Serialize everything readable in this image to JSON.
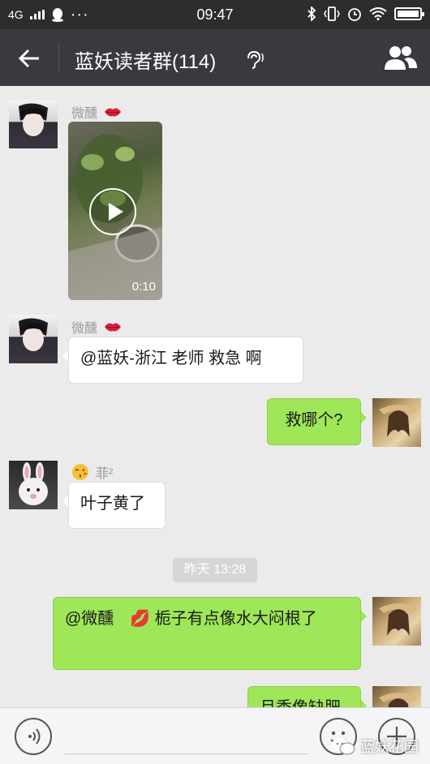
{
  "status_bar": {
    "network": "4G",
    "time": "09:47"
  },
  "header": {
    "title": "蓝妖读者群(114)"
  },
  "messages": [
    {
      "sender": "微醺",
      "type": "video",
      "duration": "0:10"
    },
    {
      "sender": "微醺",
      "text": "@蓝妖-浙江 老师 救急 啊"
    },
    {
      "self": true,
      "text": "救哪个?"
    },
    {
      "sender": "菲²",
      "text": "叶子黄了"
    },
    {
      "self": true,
      "text": "@微醺　💋 栀子有点像水大闷根了"
    },
    {
      "self": true,
      "text": "月季像缺肥"
    }
  ],
  "timestamp": "昨天 13:28",
  "watermark": "蓝妖花园",
  "colors": {
    "titlebar": "#393a3f",
    "outgoing_bubble": "#9fe658",
    "background": "#ebebeb"
  }
}
